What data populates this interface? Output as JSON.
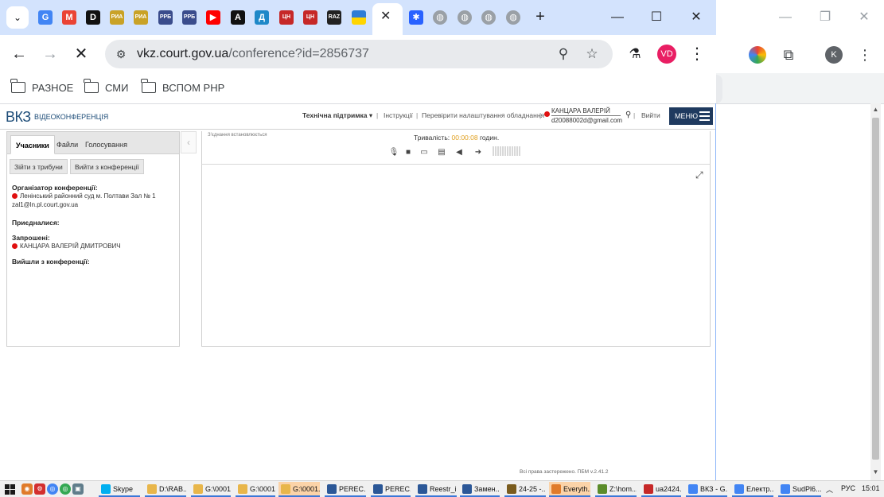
{
  "browser": {
    "url_host": "vkz.court.gov.ua",
    "url_path": "/conference?id=2856737",
    "favicons": [
      {
        "label": "G",
        "color": "#4285f4",
        "name": "google-favicon"
      },
      {
        "label": "M",
        "color": "#ea4335",
        "name": "gmail-favicon"
      },
      {
        "label": "D",
        "color": "#111111",
        "name": "d-favicon"
      },
      {
        "label": "РИА",
        "color": "#c9a227",
        "name": "ria-favicon"
      },
      {
        "label": "РИА",
        "color": "#c9a227",
        "name": "ria-favicon-2"
      },
      {
        "label": "РРБ",
        "color": "#3a4c8c",
        "name": "rrb-favicon"
      },
      {
        "label": "РРБ",
        "color": "#3a4c8c",
        "name": "rrb-favicon-2"
      },
      {
        "label": "▶",
        "color": "#ff0000",
        "name": "youtube-favicon"
      },
      {
        "label": "A",
        "color": "#111111",
        "name": "a-favicon"
      },
      {
        "label": "Д",
        "color": "#1e88c8",
        "name": "d-ua-favicon"
      },
      {
        "label": "ЦН",
        "color": "#c62828",
        "name": "cn-favicon"
      },
      {
        "label": "ЦН",
        "color": "#c62828",
        "name": "cn-favicon-2"
      },
      {
        "label": "RAZ",
        "color": "#222222",
        "name": "raz-favicon"
      },
      {
        "label": "",
        "color": "#2e7dd7",
        "name": "flag-favicon"
      }
    ],
    "bookmarks": [
      "РАЗНОЕ",
      "СМИ",
      "ВСПОМ РНР"
    ],
    "avatar_initials": "VD",
    "bg_avatar_initial": "K"
  },
  "site": {
    "logo": "ВКЗ",
    "logo_sub": "Відеоконференція",
    "support": "Технічна підтримка ▾",
    "instructions": "Інструкції",
    "check_settings": "Перевірити налаштування обладнання",
    "user_name": "КАНЦАРА ВАЛЕРІЙ",
    "user_email": "d20088002d@gmail.com",
    "logout": "Вийти",
    "menu": "МЕНЮ"
  },
  "left_panel": {
    "tabs": [
      "Учасники",
      "Файли",
      "Голосування"
    ],
    "buttons": [
      "Зійти з трибуни",
      "Вийти з конференції"
    ],
    "organizer_title": "Організатор конференції:",
    "organizer_name": "Ленінський районний суд м. Полтави Зал № 1",
    "organizer_email": "zal1@ln.pl.court.gov.ua",
    "joined_title": "Приєдналися:",
    "invited_title": "Запрошені:",
    "invited_name": "КАНЦАРА ВАЛЕРІЙ ДМИТРОВИЧ",
    "left_title": "Вийшли з конференції:"
  },
  "right_panel": {
    "connection_status": "З'єднання встановлюється",
    "duration_label": "Тривалість:",
    "duration_value": "00:00:08",
    "duration_unit": "годин."
  },
  "footer": {
    "text": "Всі права застережено. ПБМ v.2.41.2"
  },
  "taskbar": {
    "tasks": [
      {
        "label": "Skype",
        "color": "#00aff0"
      },
      {
        "label": "D:\\RAB...",
        "color": "#e8b64a"
      },
      {
        "label": "G:\\0001...",
        "color": "#e8b64a"
      },
      {
        "label": "G:\\0001...",
        "color": "#e8b64a"
      },
      {
        "label": "G:\\0001...",
        "color": "#e8b64a"
      },
      {
        "label": "PEREC...",
        "color": "#2b5797"
      },
      {
        "label": "PEREC...",
        "color": "#2b5797"
      },
      {
        "label": "Reestr_i...",
        "color": "#2b5797"
      },
      {
        "label": "Замен...",
        "color": "#2b5797"
      },
      {
        "label": "24-25 -...",
        "color": "#7a5c1e"
      },
      {
        "label": "Everyth...",
        "color": "#e07b2a"
      },
      {
        "label": "Z:\\hom...",
        "color": "#5b8c2a"
      },
      {
        "label": "ua2424...",
        "color": "#c62828"
      },
      {
        "label": "ВКЗ - G...",
        "color": "#4285f4"
      },
      {
        "label": "Електр...",
        "color": "#4285f4"
      },
      {
        "label": "SudPl6...",
        "color": "#4285f4"
      }
    ],
    "lang": "РУС",
    "time": "15:01"
  }
}
